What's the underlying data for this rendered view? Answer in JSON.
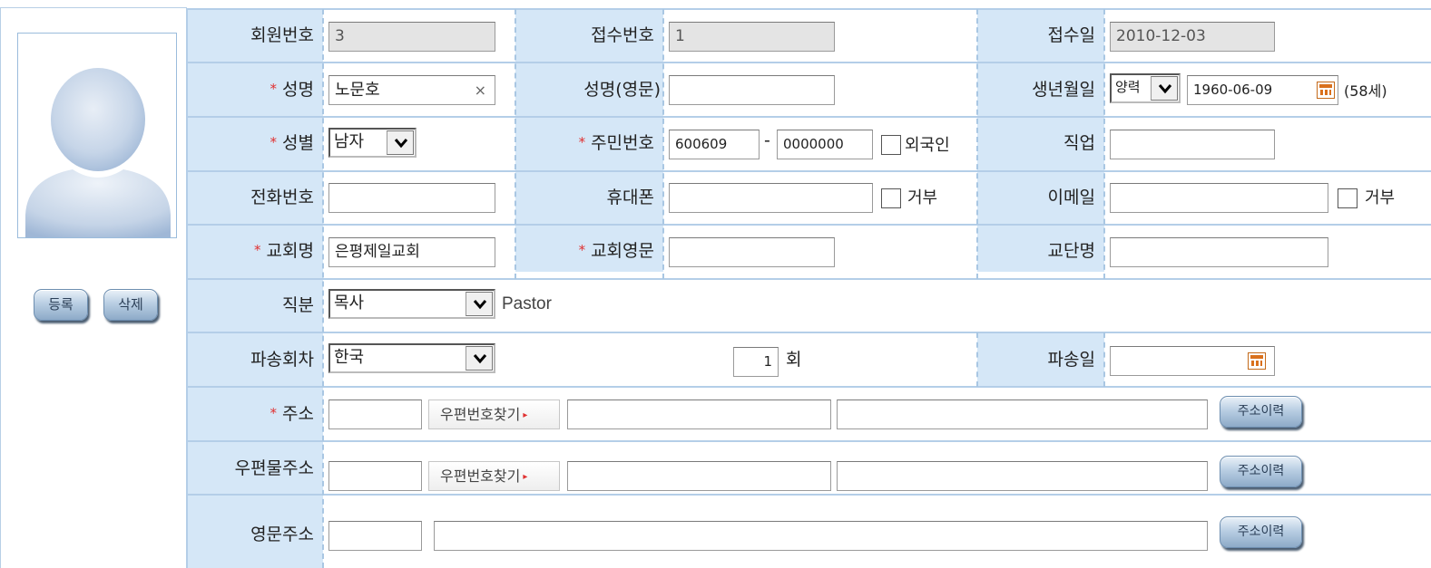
{
  "left": {
    "register_label": "등록",
    "delete_label": "삭제"
  },
  "row1": {
    "member_no_label": "회원번호",
    "member_no": "3",
    "receipt_no_label": "접수번호",
    "receipt_no": "1",
    "receipt_date_label": "접수일",
    "receipt_date": "2010-12-03"
  },
  "row2": {
    "name_label": "성명",
    "name": "노문호",
    "clear_glyph": "×",
    "name_en_label": "성명(영문)",
    "name_en": "",
    "birth_label": "생년월일",
    "calendar_type": "양력",
    "birth_date": "1960-06-09",
    "age": "(58세)"
  },
  "row3": {
    "gender_label": "성별",
    "gender": "남자",
    "rrn_label": "주민번호",
    "rrn_front": "600609",
    "rrn_dash": "-",
    "rrn_back": "0000000",
    "foreigner_label": "외국인",
    "job_label": "직업",
    "job": ""
  },
  "row4": {
    "phone_label": "전화번호",
    "phone": "",
    "mobile_label": "휴대폰",
    "mobile": "",
    "mobile_refuse_label": "거부",
    "email_label": "이메일",
    "email": "",
    "email_refuse_label": "거부"
  },
  "row5": {
    "church_label": "교회명",
    "church": "은평제일교회",
    "church_en_label": "교회영문",
    "church_en": "",
    "denomination_label": "교단명",
    "denomination": ""
  },
  "row6": {
    "position_label": "직분",
    "position": "목사",
    "position_en": "Pastor"
  },
  "row7": {
    "dispatch_round_label": "파송회차",
    "dispatch_country": "한국",
    "round_value": "1",
    "round_unit": "회",
    "dispatch_date_label": "파송일",
    "dispatch_date": ""
  },
  "row8": {
    "address_label": "주소",
    "zip_search_label": "우편번호찾기",
    "history_label": "주소이력"
  },
  "row9": {
    "mail_address_label": "우편물주소",
    "zip_search_label": "우편번호찾기",
    "history_label": "주소이력"
  },
  "row10": {
    "en_address_label": "영문주소",
    "history_label": "주소이력"
  },
  "required_mark": "*",
  "icons": {
    "calendar": "calendar-icon",
    "dropdown": "chevron-down-icon",
    "clear": "close-icon",
    "avatar": "person-silhouette-icon"
  },
  "colors": {
    "label_bg": "#d5e7f7",
    "grid_line": "#b4cee8",
    "required": "#e03030",
    "readonly_bg": "#e4e4e4"
  }
}
